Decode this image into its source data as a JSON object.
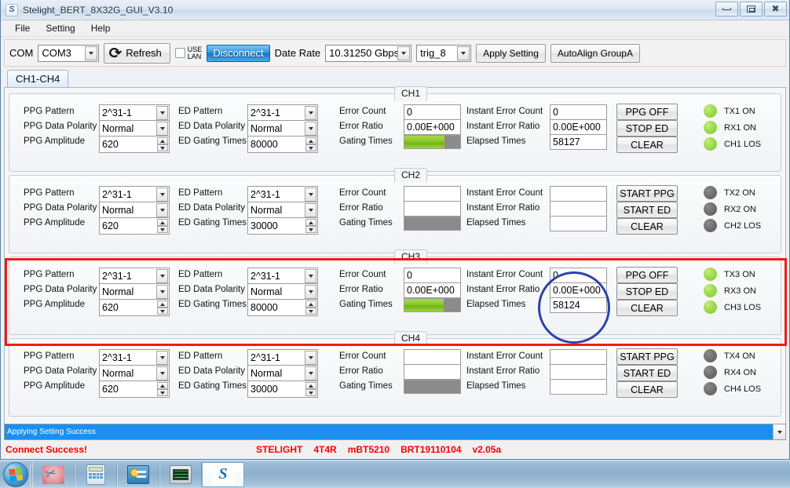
{
  "window": {
    "title": "Stelight_BERT_8X32G_GUI_V3.10",
    "icon": "app-icon",
    "minimize": "minimize-icon",
    "maximize": "maximize-icon",
    "close": "close-icon"
  },
  "menubar": {
    "items": [
      "File",
      "Setting",
      "Help"
    ]
  },
  "toolbar": {
    "com_label": "COM",
    "com_value": "COM3",
    "refresh_label": "Refresh",
    "use_lan_label_line1": "USE",
    "use_lan_label_line2": "LAN",
    "use_lan_checked": false,
    "disconnect_label": "Disconnect",
    "date_rate_label": "Date Rate",
    "date_rate_value": "10.31250 Gbps",
    "trig_value": "trig_8",
    "apply_setting_label": "Apply Setting",
    "autoalign_label": "AutoAlign GroupA"
  },
  "tabs": [
    {
      "label": "CH1-CH4",
      "selected": true
    }
  ],
  "labels": {
    "ppg_pattern": "PPG Pattern",
    "ppg_data_polarity": "PPG Data Polarity",
    "ppg_amplitude": "PPG Amplitude",
    "ed_pattern": "ED Pattern",
    "ed_data_polarity": "ED Data Polarity",
    "ed_gating_times": "ED Gating Times",
    "error_count": "Error Count",
    "error_ratio": "Error Ratio",
    "gating_times": "Gating Times",
    "instant_error_count": "Instant Error Count",
    "instant_error_ratio": "Instant Error Ratio",
    "elapsed_times": "Elapsed Times"
  },
  "channels": [
    {
      "title": "CH1",
      "ppg_pattern": "2^31-1",
      "ppg_data_polarity": "Normal",
      "ppg_amplitude": "620",
      "ed_pattern": "2^31-1",
      "ed_data_polarity": "Normal",
      "ed_gating_times": "80000",
      "error_count": "0",
      "error_ratio": "0.00E+000",
      "gating_progress": 72,
      "instant_error_count": "0",
      "instant_error_ratio": "0.00E+000",
      "elapsed_times": "58127",
      "btn_ppg": "PPG OFF",
      "btn_ed": "STOP ED",
      "btn_clear": "CLEAR",
      "leds": [
        {
          "label": "TX1 ON",
          "on": true
        },
        {
          "label": "RX1 ON",
          "on": true
        },
        {
          "label": "CH1 LOS",
          "on": true
        }
      ],
      "highlighted": false,
      "annotated": false
    },
    {
      "title": "CH2",
      "ppg_pattern": "2^31-1",
      "ppg_data_polarity": "Normal",
      "ppg_amplitude": "620",
      "ed_pattern": "2^31-1",
      "ed_data_polarity": "Normal",
      "ed_gating_times": "30000",
      "error_count": "",
      "error_ratio": "",
      "gating_progress": 0,
      "instant_error_count": "",
      "instant_error_ratio": "",
      "elapsed_times": "",
      "btn_ppg": "START PPG",
      "btn_ed": "START ED",
      "btn_clear": "CLEAR",
      "leds": [
        {
          "label": "TX2 ON",
          "on": false
        },
        {
          "label": "RX2 ON",
          "on": false
        },
        {
          "label": "CH2 LOS",
          "on": false
        }
      ],
      "highlighted": false,
      "annotated": false
    },
    {
      "title": "CH3",
      "ppg_pattern": "2^31-1",
      "ppg_data_polarity": "Normal",
      "ppg_amplitude": "620",
      "ed_pattern": "2^31-1",
      "ed_data_polarity": "Normal",
      "ed_gating_times": "80000",
      "error_count": "0",
      "error_ratio": "0.00E+000",
      "gating_progress": 70,
      "instant_error_count": "0",
      "instant_error_ratio": "0.00E+000",
      "elapsed_times": "58124",
      "btn_ppg": "PPG OFF",
      "btn_ed": "STOP ED",
      "btn_clear": "CLEAR",
      "leds": [
        {
          "label": "TX3 ON",
          "on": true
        },
        {
          "label": "RX3 ON",
          "on": true
        },
        {
          "label": "CH3 LOS",
          "on": true
        }
      ],
      "highlighted": true,
      "annotated": true
    },
    {
      "title": "CH4",
      "ppg_pattern": "2^31-1",
      "ppg_data_polarity": "Normal",
      "ppg_amplitude": "620",
      "ed_pattern": "2^31-1",
      "ed_data_polarity": "Normal",
      "ed_gating_times": "30000",
      "error_count": "",
      "error_ratio": "",
      "gating_progress": 0,
      "instant_error_count": "",
      "instant_error_ratio": "",
      "elapsed_times": "",
      "btn_ppg": "START PPG",
      "btn_ed": "START ED",
      "btn_clear": "CLEAR",
      "leds": [
        {
          "label": "TX4 ON",
          "on": false
        },
        {
          "label": "RX4 ON",
          "on": false
        },
        {
          "label": "CH4 LOS",
          "on": false
        }
      ],
      "highlighted": false,
      "annotated": false
    }
  ],
  "statuslist": {
    "selected_item": "Applying Setting Success"
  },
  "bottombar": {
    "connect_status": "Connect Success!",
    "info": [
      "STELIGHT",
      "4T4R",
      "mBT5210",
      "BRT19110104",
      "v2.05a"
    ]
  },
  "taskbar": {
    "start": "windows-start-orb",
    "items": [
      {
        "name": "snipping-tool-icon",
        "active": false
      },
      {
        "name": "calculator-icon",
        "active": false
      },
      {
        "name": "control-panel-icon",
        "active": false
      },
      {
        "name": "monitor-app-icon",
        "active": false
      },
      {
        "name": "stelight-app-icon",
        "active": true
      }
    ]
  },
  "colors": {
    "accent_blue": "#1a8ff0",
    "status_red": "#fa0000",
    "annotation_red": "#ee1c16",
    "annotation_blue": "#2e42a8",
    "led_on": "#8fcc2c",
    "led_off": "#6f6f6f"
  }
}
